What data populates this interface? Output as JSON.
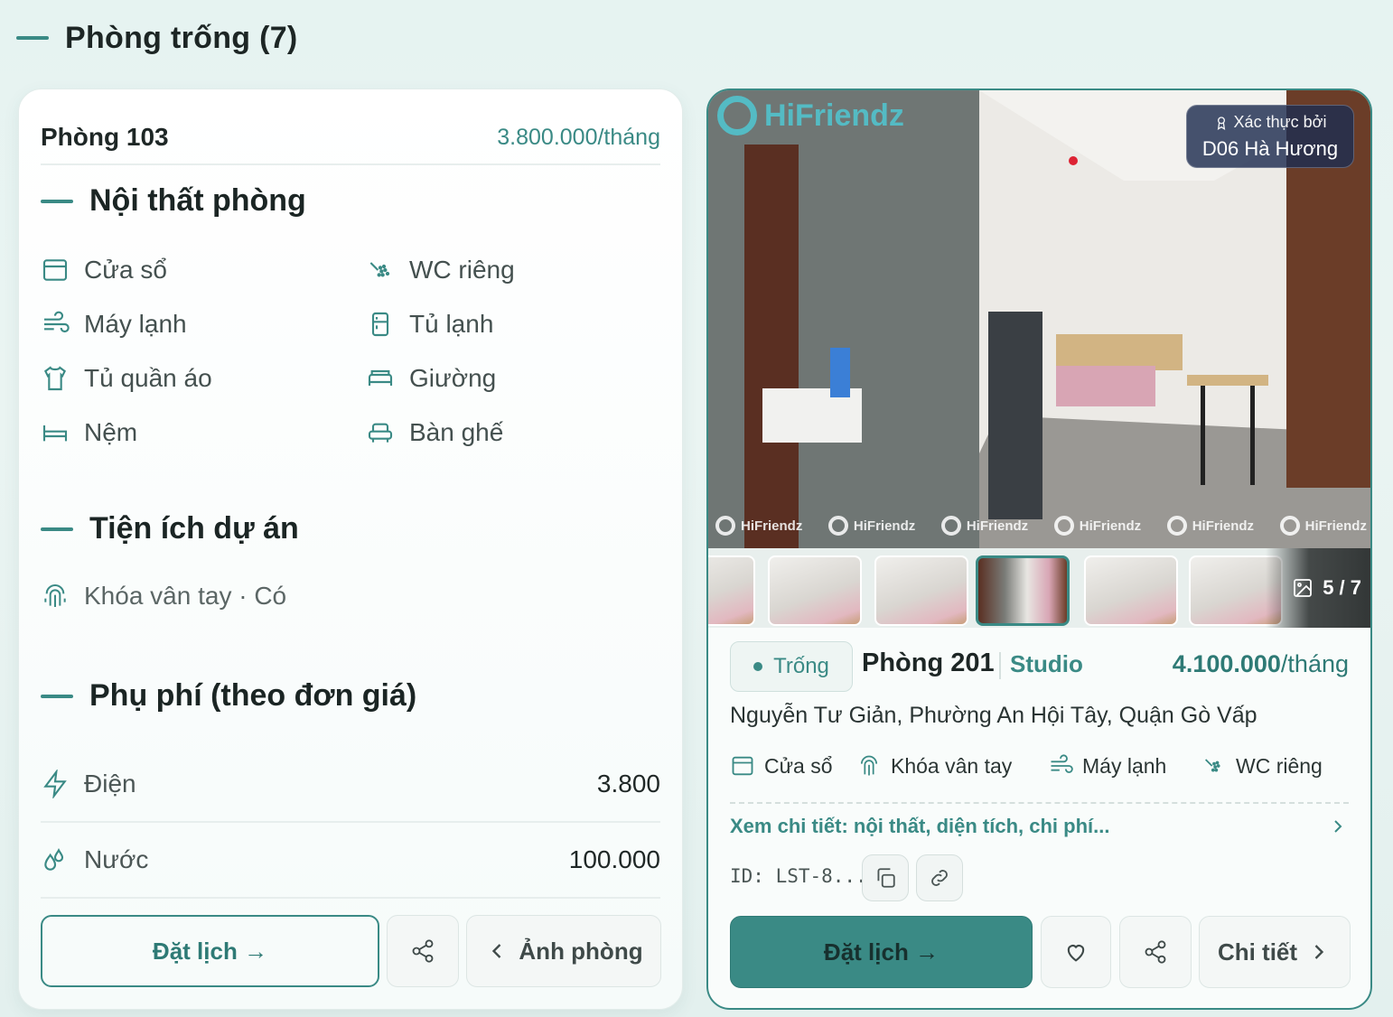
{
  "section": {
    "title": "Phòng trống (7)"
  },
  "left_card": {
    "room_name": "Phòng 103",
    "price": "3.800.000/tháng",
    "furniture_heading": "Nội thất phòng",
    "furniture": [
      {
        "label": "Cửa sổ",
        "icon": "window-icon"
      },
      {
        "label": "WC riêng",
        "icon": "shower-icon"
      },
      {
        "label": "Máy lạnh",
        "icon": "wind-icon"
      },
      {
        "label": "Tủ lạnh",
        "icon": "fridge-icon"
      },
      {
        "label": "Tủ quần áo",
        "icon": "shirt-icon"
      },
      {
        "label": "Giường",
        "icon": "bed-icon"
      },
      {
        "label": "Nệm",
        "icon": "mattress-icon"
      },
      {
        "label": "Bàn ghế",
        "icon": "armchair-icon"
      }
    ],
    "amenities_heading": "Tiện ích dự án",
    "amenity": "Khóa vân tay · Có",
    "fees_heading": "Phụ phí (theo đơn giá)",
    "fees": [
      {
        "label": "Điện",
        "value": "3.800"
      },
      {
        "label": "Nước",
        "value": "100.000"
      }
    ],
    "book_label": "Đặt lịch →",
    "photos_label": "Ảnh phòng"
  },
  "right_card": {
    "watermark": "HiFriendz",
    "verified_label": "Xác thực bởi",
    "verified_name": "D06 Hà Hương",
    "photo_counter": "5 / 7",
    "status": "Trống",
    "room_name": "Phòng 201",
    "room_type": "Studio",
    "price_amount": "4.100.000",
    "price_unit": "/tháng",
    "address": "Nguyễn Tư Giản, Phường An Hội Tây, Quận Gò Vấp",
    "features": [
      "Cửa sổ",
      "Khóa vân tay",
      "Máy lạnh",
      "WC riêng"
    ],
    "detail_link": "Xem chi tiết: nội thất, diện tích, chi phí...",
    "id_text": "ID: LST-8...",
    "book_label": "Đặt lịch →",
    "details_label": "Chi tiết"
  },
  "colors": {
    "accent": "#3a8a85",
    "text": "#1d2625",
    "verified_bg": "#1e2d50"
  }
}
